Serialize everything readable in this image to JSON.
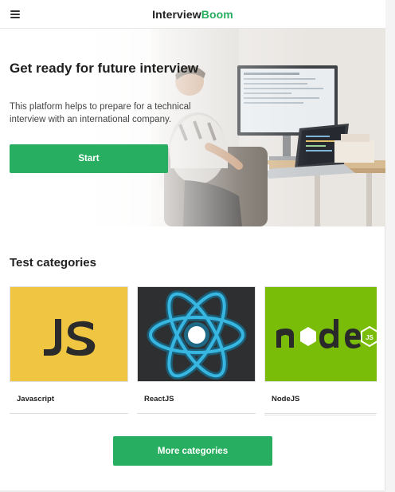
{
  "header": {
    "brand_part1": "Interview",
    "brand_part2": "Boom",
    "menu_icon": "hamburger-menu-icon"
  },
  "hero": {
    "title": "Get ready for future interview",
    "description": "This platform helps to prepare for a technical interview with an international company.",
    "start_label": "Start"
  },
  "categories": {
    "title": "Test categories",
    "items": [
      {
        "label": "Javascript",
        "icon": "javascript-logo",
        "tile_color": "#f0c541"
      },
      {
        "label": "ReactJS",
        "icon": "react-atom-logo",
        "tile_color": "#2d2f31"
      },
      {
        "label": "NodeJS",
        "icon": "nodejs-logo",
        "tile_color": "#79bd08"
      }
    ],
    "more_label": "More categories"
  },
  "colors": {
    "accent": "#27ae60",
    "text": "#222222"
  }
}
